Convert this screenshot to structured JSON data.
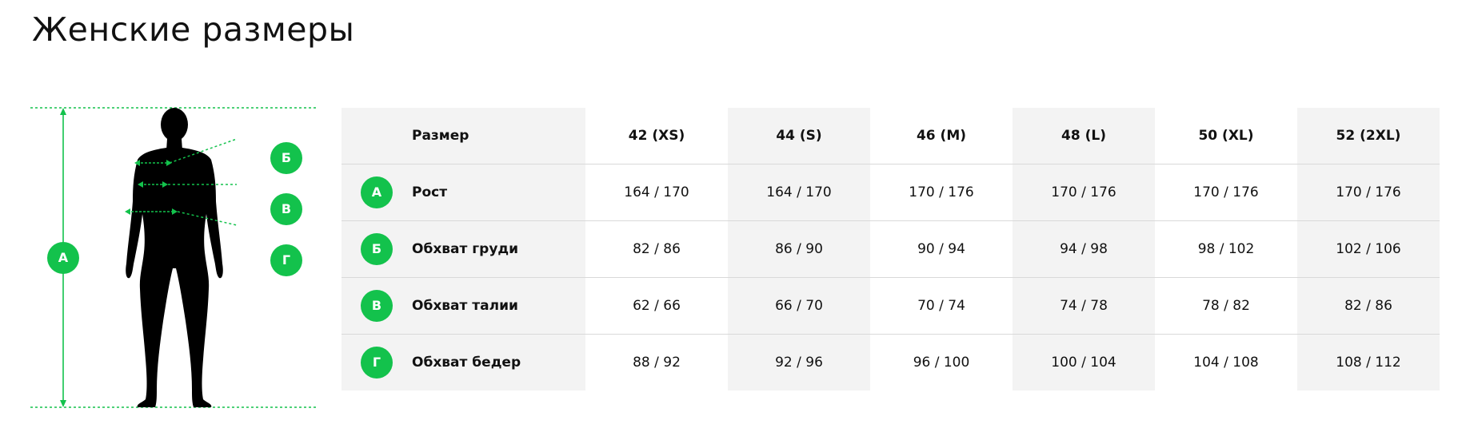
{
  "page": {
    "title": "Женские размеры"
  },
  "colors": {
    "accent_green": "#13c24c",
    "cell_shade": "#f3f3f3",
    "row_divider": "#d9d9d9",
    "silhouette": "#000000"
  },
  "figure": {
    "badges": {
      "height": "А",
      "chest": "Б",
      "waist": "В",
      "hips": "Г"
    }
  },
  "table": {
    "header_label": "Размер",
    "sizes": [
      "42 (XS)",
      "44 (S)",
      "46 (M)",
      "48 (L)",
      "50 (XL)",
      "52 (2XL)"
    ],
    "rows": [
      {
        "badge": "А",
        "label": "Рост",
        "values": [
          "164 / 170",
          "164 / 170",
          "170 / 176",
          "170 / 176",
          "170 / 176",
          "170 / 176"
        ]
      },
      {
        "badge": "Б",
        "label": "Обхват груди",
        "values": [
          "82 / 86",
          "86 / 90",
          "90 / 94",
          "94 / 98",
          "98 / 102",
          "102 / 106"
        ]
      },
      {
        "badge": "В",
        "label": "Обхват талии",
        "values": [
          "62 / 66",
          "66 / 70",
          "70 / 74",
          "74 / 78",
          "78 / 82",
          "82 / 86"
        ]
      },
      {
        "badge": "Г",
        "label": "Обхват бедер",
        "values": [
          "88 / 92",
          "92 / 96",
          "96 / 100",
          "100 / 104",
          "104 / 108",
          "108 / 112"
        ]
      }
    ]
  }
}
